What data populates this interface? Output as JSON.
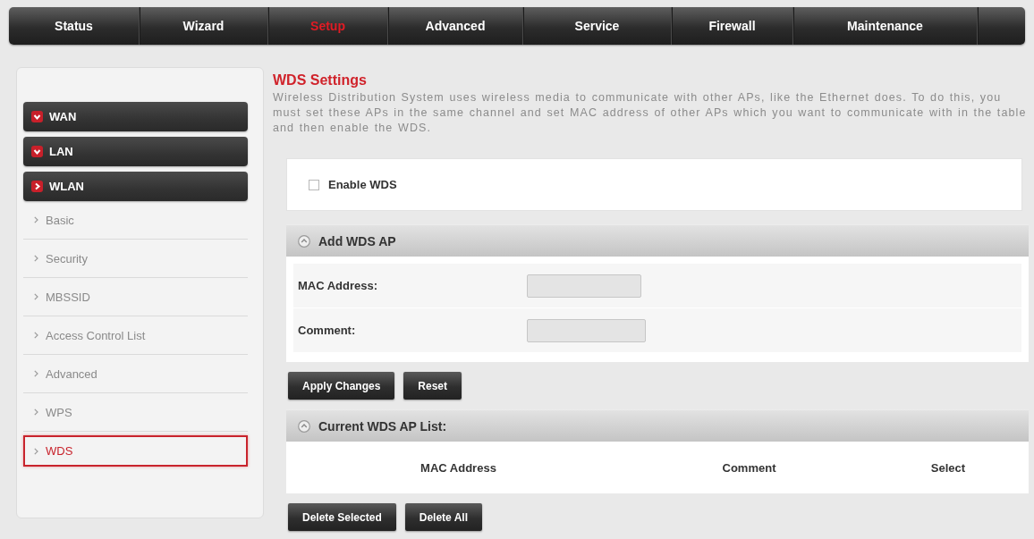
{
  "nav": {
    "tabs": [
      {
        "label": "Status",
        "selected": false
      },
      {
        "label": "Wizard",
        "selected": false
      },
      {
        "label": "Setup",
        "selected": true
      },
      {
        "label": "Advanced",
        "selected": false
      },
      {
        "label": "Service",
        "selected": false
      },
      {
        "label": "Firewall",
        "selected": false
      },
      {
        "label": "Maintenance",
        "selected": false
      }
    ]
  },
  "sidebar": {
    "groups": [
      {
        "label": "WAN",
        "expanded": false
      },
      {
        "label": "LAN",
        "expanded": false
      },
      {
        "label": "WLAN",
        "expanded": true,
        "children": [
          {
            "label": "Basic",
            "selected": false
          },
          {
            "label": "Security",
            "selected": false
          },
          {
            "label": "MBSSID",
            "selected": false
          },
          {
            "label": "Access Control List",
            "selected": false
          },
          {
            "label": "Advanced",
            "selected": false
          },
          {
            "label": "WPS",
            "selected": false
          },
          {
            "label": "WDS",
            "selected": true
          }
        ]
      }
    ]
  },
  "content": {
    "title": "WDS Settings",
    "description": "Wireless Distribution System uses wireless media to communicate with other APs, like the Ethernet does. To do this, you must set these APs in the same channel and set MAC address of other APs which you want to communicate with in the table and then enable the WDS.",
    "enable_wds": {
      "label": "Enable WDS",
      "checked": false
    },
    "add_section": {
      "title": "Add WDS AP",
      "fields": [
        {
          "label": "MAC Address:"
        },
        {
          "label": "Comment:"
        }
      ]
    },
    "add_buttons": [
      "Apply Changes",
      "Reset"
    ],
    "list_section": {
      "title": "Current WDS AP List:",
      "columns": [
        "MAC Address",
        "Comment",
        "Select"
      ]
    },
    "list_buttons": [
      "Delete Selected",
      "Delete All"
    ]
  }
}
